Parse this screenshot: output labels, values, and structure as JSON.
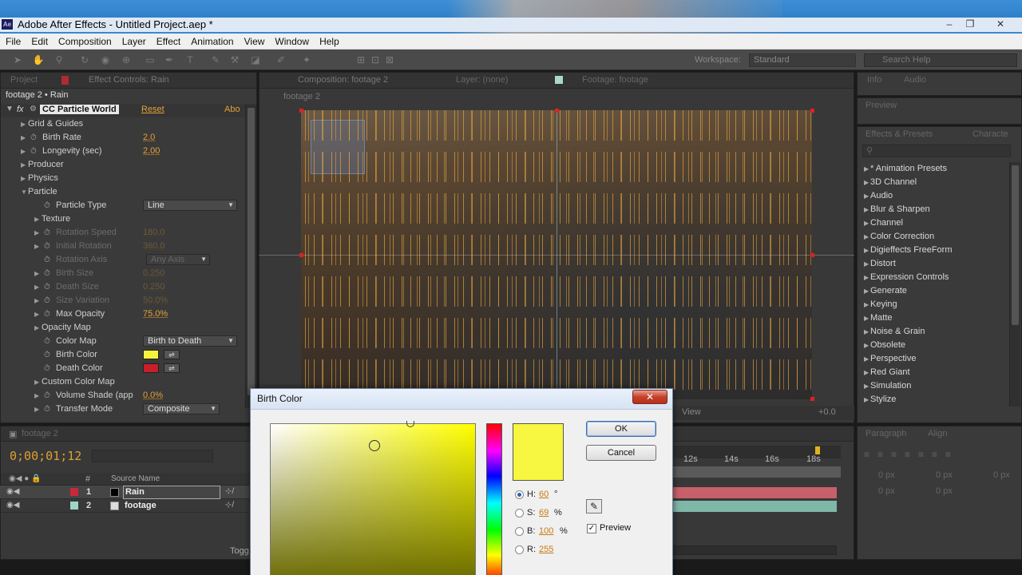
{
  "window": {
    "title": "Adobe After Effects - Untitled Project.aep *",
    "logo_text": "Ae",
    "controls": [
      "–",
      "❐",
      "✕"
    ]
  },
  "menu": [
    "File",
    "Edit",
    "Composition",
    "Layer",
    "Effect",
    "Animation",
    "View",
    "Window",
    "Help"
  ],
  "toolbar": {
    "workspace_label": "Workspace:",
    "workspace_value": "Standard",
    "search_placeholder": "Search Help"
  },
  "left_panel": {
    "tab_project": "Project",
    "tab_effect_controls": "Effect Controls: Rain",
    "layer_path": "footage 2 • Rain",
    "effect_name": "CC Particle World",
    "reset": "Reset",
    "about": "Abo",
    "rows": [
      {
        "label": "Grid & Guides",
        "type": "group"
      },
      {
        "label": "Birth Rate",
        "value": "2.0"
      },
      {
        "label": "Longevity (sec)",
        "value": "2.00"
      },
      {
        "label": "Producer",
        "type": "group"
      },
      {
        "label": "Physics",
        "type": "group"
      },
      {
        "label": "Particle",
        "type": "group"
      },
      {
        "label": "Particle Type",
        "select": "Line"
      },
      {
        "label": "Texture",
        "type": "group"
      },
      {
        "label": "Rotation Speed",
        "value": "180.0",
        "dim": true
      },
      {
        "label": "Initial Rotation",
        "value": "360.0",
        "dim": true
      },
      {
        "label": "Rotation Axis",
        "select": "Any Axis",
        "dim": true
      },
      {
        "label": "Birth Size",
        "value": "0.250",
        "dim": true
      },
      {
        "label": "Death Size",
        "value": "0.250",
        "dim": true
      },
      {
        "label": "Size Variation",
        "value": "50.0%",
        "dim": true
      },
      {
        "label": "Max Opacity",
        "value": "75.0%"
      },
      {
        "label": "Opacity Map",
        "type": "group"
      },
      {
        "label": "Color Map",
        "select": "Birth to Death"
      },
      {
        "label": "Birth Color",
        "color": "#f4f43c"
      },
      {
        "label": "Death Color",
        "color": "#c81e2a"
      },
      {
        "label": "Custom Color Map",
        "type": "group"
      },
      {
        "label": "Volume Shade (app",
        "value": "0.0%"
      },
      {
        "label": "Transfer Mode",
        "select": "Composite"
      }
    ]
  },
  "comp_panel": {
    "tab_composition": "Composition: footage 2",
    "tab_layer": "Layer: (none)",
    "tab_footage": "Footage: footage",
    "breadcrumb": "footage 2",
    "view_label": "View",
    "offset": "+0.0"
  },
  "right_panel": {
    "tab_info": "Info",
    "tab_audio": "Audio",
    "tab_preview": "Preview",
    "tab_effects": "Effects & Presets",
    "tab_character": "Characte",
    "effects": [
      "* Animation Presets",
      "3D Channel",
      "Audio",
      "Blur & Sharpen",
      "Channel",
      "Color Correction",
      "Digieffects FreeForm",
      "Distort",
      "Expression Controls",
      "Generate",
      "Keying",
      "Matte",
      "Noise & Grain",
      "Obsolete",
      "Perspective",
      "Red Giant",
      "Simulation",
      "Stylize"
    ],
    "tab_paragraph": "Paragraph",
    "tab_align": "Align",
    "px_values": [
      "0 px",
      "0 px",
      "0 px",
      "0 px",
      "0 px"
    ]
  },
  "timeline": {
    "tab": "footage 2",
    "timecode": "0;00;01;12",
    "col_hash": "#",
    "col_source": "Source Name",
    "layers": [
      {
        "num": "1",
        "name": "Rain",
        "label_color": "#c8283a",
        "bar_color": "#c7606a"
      },
      {
        "num": "2",
        "name": "footage",
        "label_color": "#9fd6c9",
        "bar_color": "#7fb8a8"
      }
    ],
    "ruler": [
      "12s",
      "14s",
      "16s",
      "18s"
    ],
    "toggle": "Togg"
  },
  "dialog": {
    "title": "Birth Color",
    "ok": "OK",
    "cancel": "Cancel",
    "preview_label": "Preview",
    "current_color": "#f7f640",
    "fields": [
      {
        "key": "H:",
        "value": "60",
        "unit": "°",
        "selected": true
      },
      {
        "key": "S:",
        "value": "69",
        "unit": "%"
      },
      {
        "key": "B:",
        "value": "100",
        "unit": "%"
      },
      {
        "key": "R:",
        "value": "255",
        "unit": ""
      }
    ]
  }
}
